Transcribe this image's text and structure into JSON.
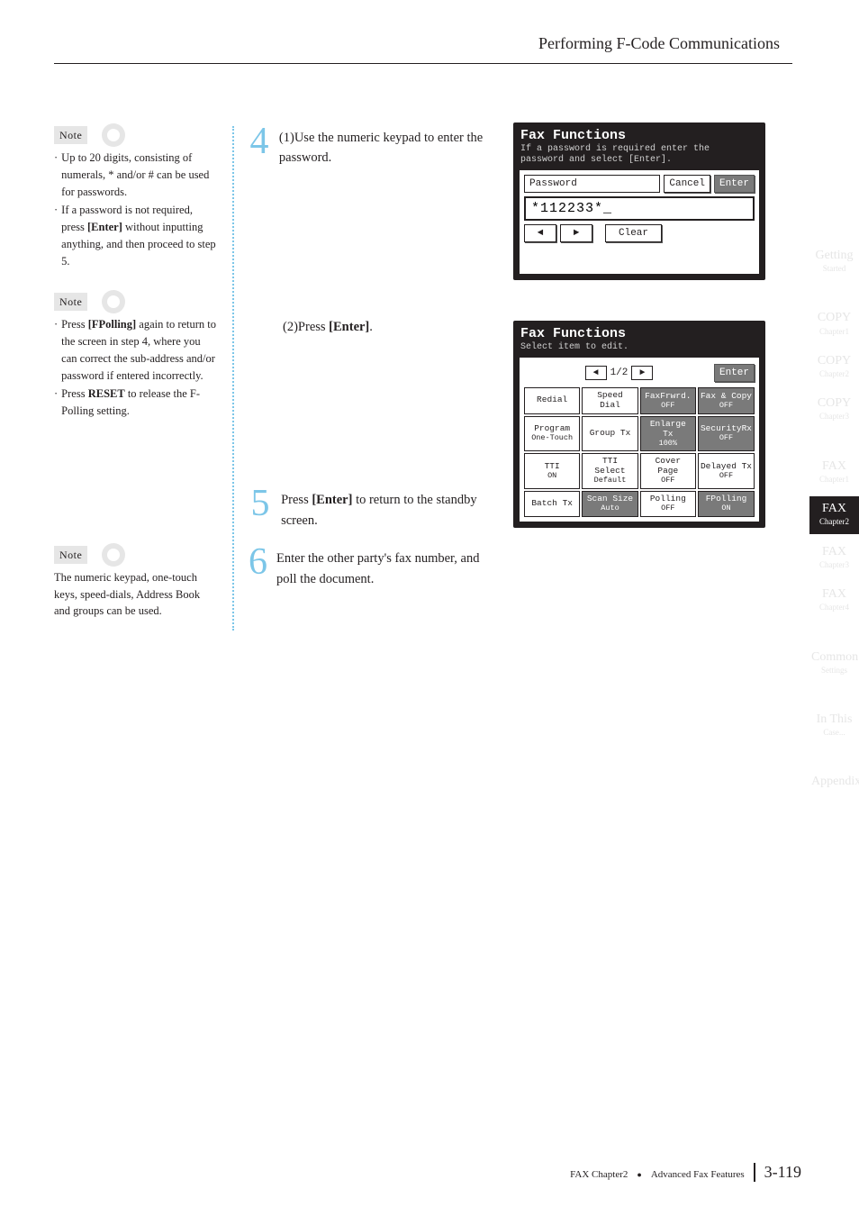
{
  "running_head": "Performing F-Code Communications",
  "notes": {
    "label": "Note",
    "block1": {
      "b1_pre": "· ",
      "b1": "Up to 20 digits, consisting of numerals, * and/or # can be used for passwords.",
      "b2_pre": "· ",
      "b2a": "If a password is not required, press ",
      "b2_bold": "[Enter]",
      "b2b": " without inputting anything, and then proceed to step 5."
    },
    "block2": {
      "b1_pre": "· ",
      "b1a": "Press ",
      "b1_bold": "[FPolling]",
      "b1b": " again to return to the screen in step 4, where you can correct the sub-address and/or password if entered incorrectly.",
      "b2_pre": "· ",
      "b2a": "Press ",
      "b2_bold": "RESET",
      "b2b": " to release the F-Polling setting."
    },
    "block3": {
      "text": "The numeric keypad, one-touch keys, speed-dials, Address Book and groups can be used."
    }
  },
  "steps": {
    "s4": {
      "num": "4",
      "line1_pre": "(1)",
      "line1": "Use the numeric keypad to enter the password.",
      "line2_pre": "(2)",
      "line2a": "Press ",
      "line2_bold": "[Enter]",
      "line2b": "."
    },
    "s5": {
      "num": "5",
      "a": "Press ",
      "bold": "[Enter]",
      "b": " to return to the standby screen."
    },
    "s6": {
      "num": "6",
      "text": "Enter the other party's fax number, and poll the document."
    }
  },
  "lcd1": {
    "title": "Fax Functions",
    "sub": "If a password is required enter\nthe password and select [Enter].",
    "password_label": "Password",
    "cancel": "Cancel",
    "enter": "Enter",
    "value": "*112233*_",
    "left": "◄",
    "right": "►",
    "clear": "Clear"
  },
  "lcd2": {
    "title": "Fax Functions",
    "sub": "Select item to edit.",
    "left": "◄",
    "page": "1/2",
    "right": "►",
    "enter": "Enter",
    "grid": [
      [
        {
          "t": "Redial",
          "dark": false
        },
        {
          "t": "Speed Dial",
          "dark": false
        },
        {
          "t": "FaxFrwrd.",
          "s": "OFF",
          "dark": true
        },
        {
          "t": "Fax & Copy",
          "s": "OFF",
          "dark": true
        }
      ],
      [
        {
          "t": "Program",
          "s": "One-Touch",
          "dark": false
        },
        {
          "t": "Group Tx",
          "dark": false
        },
        {
          "t": "Enlarge Tx",
          "s": "100%",
          "dark": true
        },
        {
          "t": "SecurityRx",
          "s": "OFF",
          "dark": true
        }
      ],
      [
        {
          "t": "TTI",
          "s": "ON",
          "dark": false
        },
        {
          "t": "TTI Select",
          "s": "Default",
          "dark": false
        },
        {
          "t": "Cover Page",
          "s": "OFF",
          "dark": false
        },
        {
          "t": "Delayed Tx",
          "s": "OFF",
          "dark": false
        }
      ],
      [
        {
          "t": "Batch Tx",
          "dark": false
        },
        {
          "t": "Scan Size",
          "s": "Auto",
          "dark": true
        },
        {
          "t": "Polling",
          "s": "OFF",
          "dark": false
        },
        {
          "t": "FPolling",
          "s": "ON",
          "dark": true
        }
      ]
    ]
  },
  "tabs": [
    {
      "big": "Getting",
      "small": "Started",
      "active": false
    },
    {
      "spacer": true
    },
    {
      "big": "COPY",
      "small": "Chapter1",
      "active": false
    },
    {
      "big": "COPY",
      "small": "Chapter2",
      "active": false
    },
    {
      "big": "COPY",
      "small": "Chapter3",
      "active": false
    },
    {
      "spacer": true
    },
    {
      "big": "FAX",
      "small": "Chapter1",
      "active": false
    },
    {
      "big": "FAX",
      "small": "Chapter2",
      "active": true
    },
    {
      "big": "FAX",
      "small": "Chapter3",
      "active": false
    },
    {
      "big": "FAX",
      "small": "Chapter4",
      "active": false
    },
    {
      "spacer": true
    },
    {
      "big": "Common",
      "small": "Settings",
      "active": false
    },
    {
      "spacer": true
    },
    {
      "big": "In This",
      "small": "Case...",
      "active": false
    },
    {
      "spacer": true
    },
    {
      "big": "Appendix",
      "small": "",
      "active": false
    }
  ],
  "footer": {
    "text_a": "FAX Chapter2 ",
    "bullet": "●",
    "text_b": " Advanced Fax Features",
    "page": "3-119"
  }
}
